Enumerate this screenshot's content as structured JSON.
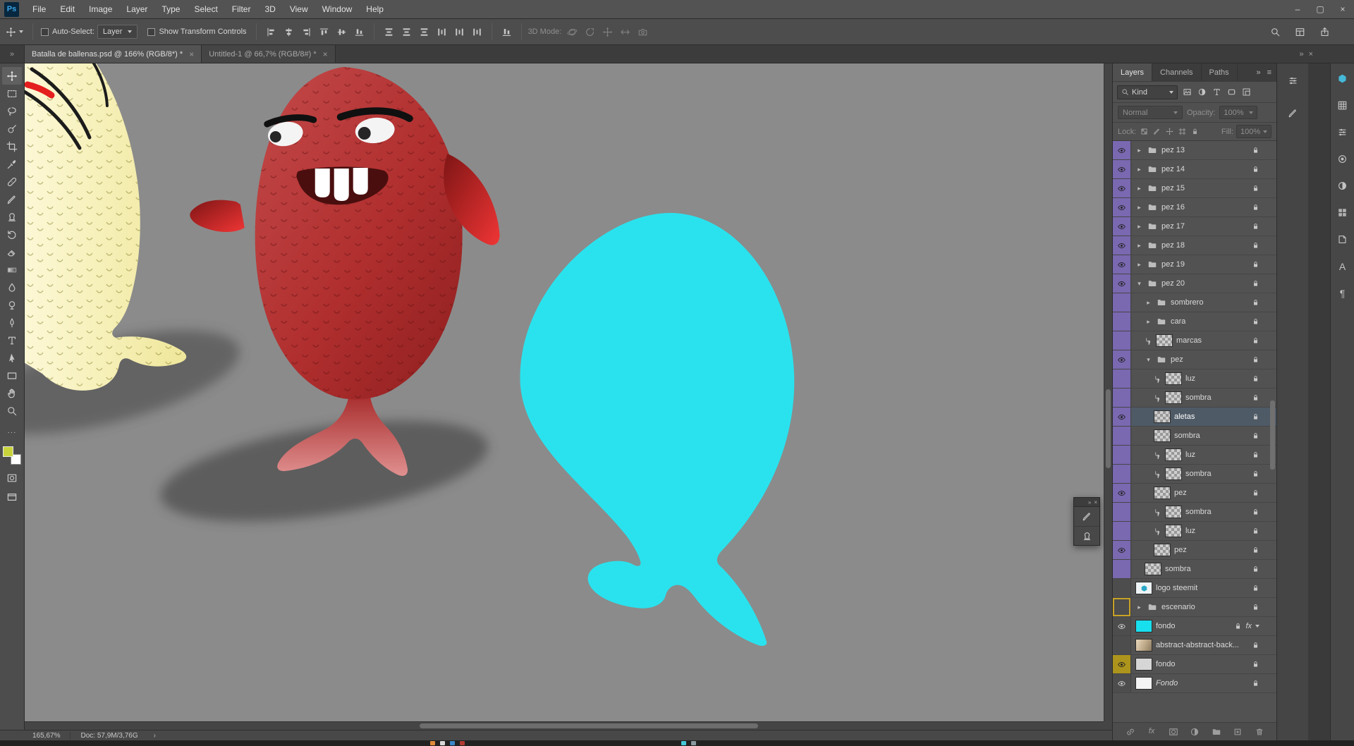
{
  "app": {
    "logo_text": "Ps",
    "window_controls": [
      {
        "label": "–",
        "name": "minimize"
      },
      {
        "label": "▢",
        "name": "maximize"
      },
      {
        "label": "×",
        "name": "close"
      }
    ]
  },
  "menubar": {
    "items": [
      "File",
      "Edit",
      "Image",
      "Layer",
      "Type",
      "Select",
      "Filter",
      "3D",
      "View",
      "Window",
      "Help"
    ]
  },
  "options_bar": {
    "tool_icon": "move",
    "auto_select_label": "Auto-Select:",
    "auto_select_value": "Layer",
    "show_transform_label": "Show Transform Controls",
    "align_icons": [
      "align-left",
      "align-center",
      "align-right",
      "align-top",
      "align-mid",
      "align-bottom"
    ],
    "distribute_icons": [
      "dist-top",
      "dist-middle",
      "dist-bottom",
      "dist-left",
      "dist-center",
      "dist-right"
    ],
    "extra_icon": "align-to",
    "mode_label": "3D Mode:",
    "mode_icons": [
      "orbit",
      "roll",
      "pan",
      "slide",
      "camera"
    ],
    "right_icons": [
      "search",
      "workspace",
      "share"
    ]
  },
  "dock_headers": {
    "collapse": "»",
    "close": "×"
  },
  "tabs": [
    {
      "title": "Batalla de ballenas.psd @ 166% (RGB/8*) *",
      "active": true
    },
    {
      "title": "Untitled-1 @ 66,7% (RGB/8#) *",
      "active": false
    }
  ],
  "toolbar": {
    "tools": [
      {
        "name": "move",
        "active": true
      },
      {
        "name": "marquee"
      },
      {
        "name": "lasso"
      },
      {
        "name": "quick-select"
      },
      {
        "name": "crop"
      },
      {
        "name": "eyedropper"
      },
      {
        "name": "healing"
      },
      {
        "name": "brush"
      },
      {
        "name": "clone-stamp"
      },
      {
        "name": "history-brush"
      },
      {
        "name": "eraser"
      },
      {
        "name": "gradient"
      },
      {
        "name": "blur"
      },
      {
        "name": "dodge"
      },
      {
        "name": "pen"
      },
      {
        "name": "type"
      },
      {
        "name": "path-select"
      },
      {
        "name": "rectangle"
      },
      {
        "name": "hand"
      },
      {
        "name": "zoom"
      }
    ],
    "more_icon": "ellipsis",
    "foreground_color": "#c9d43c",
    "background_color": "#ffffff",
    "extra_tools": [
      "quick-mask",
      "screen-mode"
    ]
  },
  "canvas": {
    "background": "#8b8b8b",
    "whale_color": "#2ae2ee",
    "fish_red_light": "#c44a4a",
    "fish_red_main": "#b02e2e",
    "fish_red_dark": "#8e1f1f",
    "fish_yellow_light": "#fffbe0",
    "fish_yellow_main": "#efe79a"
  },
  "floating_panel": {
    "collapse_icon": "»",
    "close_icon": "×",
    "buttons": [
      "brush-settings",
      "clone-source"
    ]
  },
  "layers_panel": {
    "tabs": [
      {
        "label": "Layers",
        "active": true
      },
      {
        "label": "Channels",
        "active": false
      },
      {
        "label": "Paths",
        "active": false
      }
    ],
    "collapse_icon": "»",
    "menu_icon": "≡",
    "filter": {
      "kind_label": "Kind",
      "filter_icons": [
        "px",
        "adjust",
        "type",
        "shape",
        "smart"
      ]
    },
    "blend": {
      "mode": "Normal",
      "opacity_label": "Opacity:",
      "opacity_value": "100%"
    },
    "lock_row": {
      "label": "Lock:",
      "icons": [
        "lock-transparent",
        "lock-paint",
        "lock-position",
        "lock-artboard",
        "lock-all"
      ],
      "fill_label": "Fill:",
      "fill_value": "100%"
    },
    "fx_badge": "fx",
    "rows": [
      {
        "name": "pez 13",
        "kind": "group",
        "indent": 0,
        "eye": true,
        "tint": "violet",
        "twirl": "right"
      },
      {
        "name": "pez 14",
        "kind": "group",
        "indent": 0,
        "eye": true,
        "tint": "violet",
        "twirl": "right"
      },
      {
        "name": "pez 15",
        "kind": "group",
        "indent": 0,
        "eye": true,
        "tint": "violet",
        "twirl": "right"
      },
      {
        "name": "pez 16",
        "kind": "group",
        "indent": 0,
        "eye": true,
        "tint": "violet",
        "twirl": "right"
      },
      {
        "name": "pez 17",
        "kind": "group",
        "indent": 0,
        "eye": true,
        "tint": "violet",
        "twirl": "right"
      },
      {
        "name": "pez 18",
        "kind": "group",
        "indent": 0,
        "eye": true,
        "tint": "violet",
        "twirl": "right"
      },
      {
        "name": "pez 19",
        "kind": "group",
        "indent": 0,
        "eye": true,
        "tint": "violet",
        "twirl": "right"
      },
      {
        "name": "pez 20",
        "kind": "group",
        "indent": 0,
        "eye": true,
        "tint": "violet",
        "twirl": "down"
      },
      {
        "name": "sombrero",
        "kind": "group",
        "indent": 1,
        "eye": false,
        "tint": "violet",
        "twirl": "right"
      },
      {
        "name": "cara",
        "kind": "group",
        "indent": 1,
        "eye": false,
        "tint": "violet",
        "twirl": "right"
      },
      {
        "name": "marcas",
        "kind": "layer",
        "indent": 1,
        "eye": false,
        "tint": "violet",
        "clip": true,
        "thumb": "checker"
      },
      {
        "name": "pez",
        "kind": "group",
        "indent": 1,
        "eye": true,
        "tint": "violet",
        "twirl": "down"
      },
      {
        "name": "luz",
        "kind": "layer",
        "indent": 2,
        "eye": false,
        "tint": "violet",
        "clip": true,
        "thumb": "checker"
      },
      {
        "name": "sombra",
        "kind": "layer",
        "indent": 2,
        "eye": false,
        "tint": "violet",
        "clip": true,
        "thumb": "checker"
      },
      {
        "name": "aletas",
        "kind": "layer",
        "indent": 2,
        "eye": true,
        "tint": "violet",
        "thumb": "checker",
        "selected": true
      },
      {
        "name": "sombra",
        "kind": "layer",
        "indent": 2,
        "eye": false,
        "tint": "violet",
        "thumb": "checker"
      },
      {
        "name": "luz",
        "kind": "layer",
        "indent": 2,
        "eye": false,
        "tint": "violet",
        "clip": true,
        "thumb": "checker"
      },
      {
        "name": "sombra",
        "kind": "layer",
        "indent": 2,
        "eye": false,
        "tint": "violet",
        "clip": true,
        "thumb": "checker"
      },
      {
        "name": "pez",
        "kind": "layer",
        "indent": 2,
        "eye": true,
        "tint": "violet",
        "thumb": "checker"
      },
      {
        "name": "sombra",
        "kind": "layer",
        "indent": 2,
        "eye": false,
        "tint": "violet",
        "clip": true,
        "thumb": "checker"
      },
      {
        "name": "luz",
        "kind": "layer",
        "indent": 2,
        "eye": false,
        "tint": "violet",
        "clip": true,
        "thumb": "checker"
      },
      {
        "name": "pez",
        "kind": "layer",
        "indent": 2,
        "eye": true,
        "tint": "violet",
        "thumb": "checker"
      },
      {
        "name": "sombra",
        "kind": "layer",
        "indent": 1,
        "eye": false,
        "tint": "violet",
        "thumb": "checker"
      },
      {
        "name": "logo steemit",
        "kind": "layer",
        "indent": 0,
        "eye": false,
        "tint": "none",
        "thumb": "steemit"
      },
      {
        "name": "escenario",
        "kind": "group",
        "indent": 0,
        "eye": false,
        "tint": "yellow-border",
        "twirl": "right"
      },
      {
        "name": "fondo",
        "kind": "layer",
        "indent": 0,
        "eye": true,
        "tint": "none",
        "thumb": "cyan",
        "fx": true
      },
      {
        "name": "abstract-abstract-back...",
        "kind": "layer",
        "indent": 0,
        "eye": false,
        "tint": "none",
        "thumb": "beige"
      },
      {
        "name": "fondo",
        "kind": "layer",
        "indent": 0,
        "eye": true,
        "tint": "yellow",
        "thumb": "lightgray"
      },
      {
        "name": "Fondo",
        "kind": "layer",
        "indent": 0,
        "eye": true,
        "tint": "none",
        "thumb": "white",
        "italic": true
      }
    ],
    "bottom_icons": [
      "link",
      "fx",
      "mask",
      "adjustment",
      "folder",
      "new-layer",
      "trash"
    ]
  },
  "mid_dock": {
    "icons": [
      "properties",
      "brush-settings"
    ]
  },
  "right_strip": {
    "icons": [
      "library",
      "swatches",
      "adjust-sliders",
      "color",
      "adjustments",
      "patterns",
      "styles",
      "character",
      "paragraph"
    ]
  },
  "status_bar": {
    "zoom": "165,67%",
    "doc": "Doc: 57,9M/3,76G",
    "chevron": "›"
  },
  "taskbar": {
    "dots": [
      "#e08b3a",
      "#d8d8d8",
      "#3a86c8",
      "#b03a30",
      "#45c8d8",
      "#8a9aa0"
    ]
  }
}
